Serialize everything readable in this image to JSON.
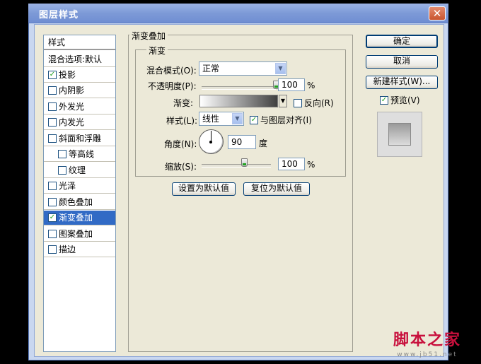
{
  "window": {
    "title": "图层样式",
    "close_glyph": "✕"
  },
  "left_list": {
    "header": "样式",
    "blend_default": "混合选项:默认",
    "items": [
      {
        "label": "投影",
        "checked": true
      },
      {
        "label": "内阴影",
        "checked": false
      },
      {
        "label": "外发光",
        "checked": false
      },
      {
        "label": "内发光",
        "checked": false
      },
      {
        "label": "斜面和浮雕",
        "checked": false
      },
      {
        "label": "等高线",
        "checked": false
      },
      {
        "label": "纹理",
        "checked": false
      },
      {
        "label": "光泽",
        "checked": false
      },
      {
        "label": "颜色叠加",
        "checked": false
      },
      {
        "label": "渐变叠加",
        "checked": true,
        "selected": true
      },
      {
        "label": "图案叠加",
        "checked": false
      },
      {
        "label": "描边",
        "checked": false
      }
    ]
  },
  "panel": {
    "section_title": "渐变叠加",
    "group_title": "渐变",
    "blend_mode": {
      "label": "混合模式(O):",
      "value": "正常"
    },
    "opacity": {
      "label": "不透明度(P):",
      "value": "100",
      "unit": "%",
      "fraction": 1.0
    },
    "gradient": {
      "label": "渐变:",
      "reverse_label": "反向(R)",
      "reverse_checked": false
    },
    "style": {
      "label": "样式(L):",
      "value": "线性",
      "align_label": "与图层对齐(I)",
      "align_checked": true
    },
    "angle": {
      "label": "角度(N):",
      "value": "90",
      "unit": "度"
    },
    "scale": {
      "label": "缩放(S):",
      "value": "100",
      "unit": "%",
      "fraction": 0.62
    },
    "set_default": "设置为默认值",
    "reset_default": "复位为默认值"
  },
  "right_buttons": {
    "ok": "确定",
    "cancel": "取消",
    "new_style": "新建样式(W)...",
    "preview_label": "预览(V)",
    "preview_checked": true
  },
  "watermark": {
    "text": "脚本之家",
    "url": "www.jb51.net"
  },
  "colors": {
    "selection": "#316ac5",
    "titlebar": "#7d9ad7",
    "dialog_bg": "#ece9d8",
    "check": "#21a121"
  }
}
